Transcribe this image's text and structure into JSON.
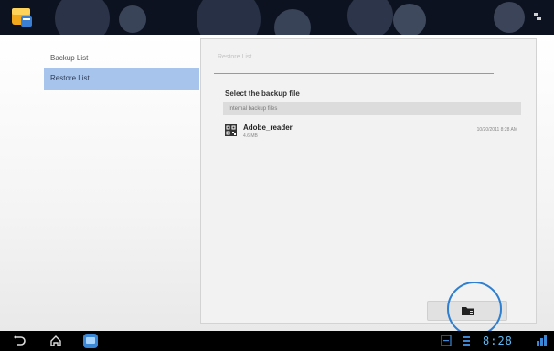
{
  "app": {
    "icon": "app-box-icon",
    "menu_icon": "overflow-menu-icon"
  },
  "sidebar": {
    "items": [
      {
        "label": "Backup List",
        "active": false
      },
      {
        "label": "Restore List",
        "active": true
      }
    ]
  },
  "panel": {
    "tab_title": "Restore List",
    "section_title": "Select the backup file",
    "group_header": "Internal backup files",
    "files": [
      {
        "name": "Adobe_reader",
        "size": "4.6 MB",
        "date": "10/20/2011 8:28 AM",
        "icon": "qr-archive-icon"
      }
    ],
    "folder_button_icon": "folder-icon"
  },
  "navbar": {
    "back_icon": "back-icon",
    "home_icon": "home-icon",
    "recent_icon": "recent-apps-icon",
    "status_icons": [
      "gallery-icon",
      "notification-icon"
    ],
    "clock": "8:28",
    "signal_icon": "signal-icon"
  },
  "colors": {
    "topbar": "#0c1220",
    "selected": "#a7c4ec",
    "ring": "#2f7fd0",
    "clock": "#5fb8f0"
  }
}
